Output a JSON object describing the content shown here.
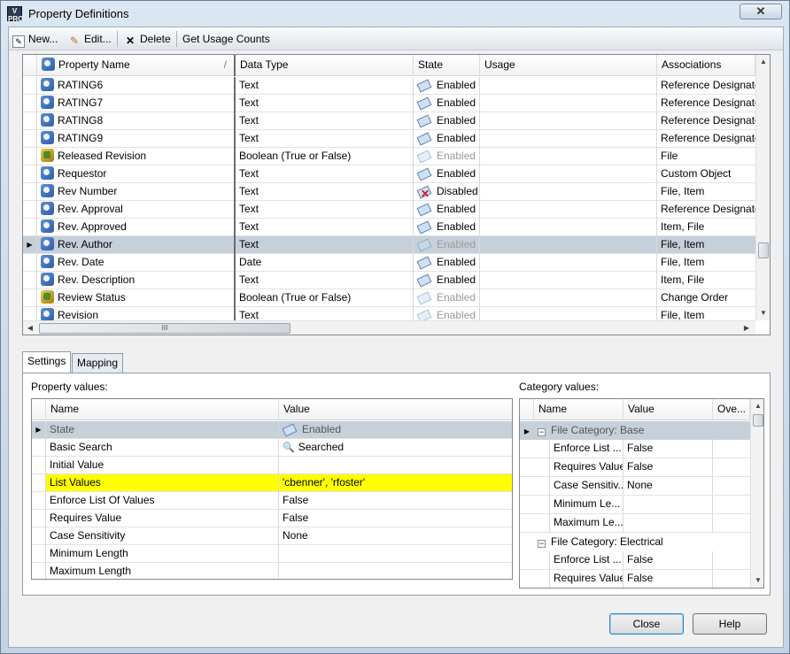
{
  "window": {
    "title": "Property Definitions",
    "close_glyph": "✕"
  },
  "toolbar": {
    "new_label": "New...",
    "edit_label": "Edit...",
    "delete_label": "Delete",
    "usage_label": "Get Usage Counts"
  },
  "property_grid": {
    "columns": [
      "Property Name",
      "Data Type",
      "State",
      "Usage",
      "Associations"
    ],
    "rows": [
      {
        "name": "RATING6",
        "type": "Text",
        "state": "Enabled",
        "state_style": "enabled",
        "usage": "",
        "assoc": "Reference Designator",
        "icon": "text"
      },
      {
        "name": "RATING7",
        "type": "Text",
        "state": "Enabled",
        "state_style": "enabled",
        "usage": "",
        "assoc": "Reference Designator",
        "icon": "text"
      },
      {
        "name": "RATING8",
        "type": "Text",
        "state": "Enabled",
        "state_style": "enabled",
        "usage": "",
        "assoc": "Reference Designator",
        "icon": "text"
      },
      {
        "name": "RATING9",
        "type": "Text",
        "state": "Enabled",
        "state_style": "enabled",
        "usage": "",
        "assoc": "Reference Designator",
        "icon": "text"
      },
      {
        "name": "Released Revision",
        "type": "Boolean (True or False)",
        "state": "Enabled",
        "state_style": "dim",
        "usage": "",
        "assoc": "File",
        "icon": "bool"
      },
      {
        "name": "Requestor",
        "type": "Text",
        "state": "Enabled",
        "state_style": "enabled",
        "usage": "",
        "assoc": "Custom Object",
        "icon": "text"
      },
      {
        "name": "Rev Number",
        "type": "Text",
        "state": "Disabled",
        "state_style": "disabled",
        "usage": "",
        "assoc": "File, Item",
        "icon": "text"
      },
      {
        "name": "Rev. Approval",
        "type": "Text",
        "state": "Enabled",
        "state_style": "enabled",
        "usage": "",
        "assoc": "Reference Designator",
        "icon": "text"
      },
      {
        "name": "Rev. Approved",
        "type": "Text",
        "state": "Enabled",
        "state_style": "enabled",
        "usage": "",
        "assoc": "Item, File",
        "icon": "text"
      },
      {
        "name": "Rev. Author",
        "type": "Text",
        "state": "Enabled",
        "state_style": "dim",
        "usage": "",
        "assoc": "File, Item",
        "icon": "text",
        "selected": true
      },
      {
        "name": "Rev. Date",
        "type": "Date",
        "state": "Enabled",
        "state_style": "enabled",
        "usage": "",
        "assoc": "File, Item",
        "icon": "text"
      },
      {
        "name": "Rev. Description",
        "type": "Text",
        "state": "Enabled",
        "state_style": "enabled",
        "usage": "",
        "assoc": "Item, File",
        "icon": "text"
      },
      {
        "name": "Review Status",
        "type": "Boolean (True or False)",
        "state": "Enabled",
        "state_style": "dim",
        "usage": "",
        "assoc": "Change Order",
        "icon": "bool"
      },
      {
        "name": "Revision",
        "type": "Text",
        "state": "Enabled",
        "state_style": "dim",
        "usage": "",
        "assoc": "File, Item",
        "icon": "text"
      }
    ],
    "hscroll_grip": "III"
  },
  "tabs": [
    "Settings",
    "Mapping"
  ],
  "settings": {
    "property_values_label": "Property values:",
    "category_values_label": "Category values:",
    "pv_columns": [
      "Name",
      "Value"
    ],
    "pv_rows": [
      {
        "name": "State",
        "value": "Enabled",
        "icon": "state",
        "selected": true
      },
      {
        "name": "Basic Search",
        "value": "Searched",
        "icon": "search"
      },
      {
        "name": "Initial Value",
        "value": ""
      },
      {
        "name": "List Values",
        "value": "'cbenner', 'rfoster'",
        "highlight": true
      },
      {
        "name": "Enforce List Of Values",
        "value": "False"
      },
      {
        "name": "Requires Value",
        "value": "False"
      },
      {
        "name": "Case Sensitivity",
        "value": "None"
      },
      {
        "name": "Minimum Length",
        "value": ""
      },
      {
        "name": "Maximum Length",
        "value": ""
      }
    ],
    "cv_columns": [
      "Name",
      "Value",
      "Ove..."
    ],
    "cv_groups": [
      {
        "label": "File Category: Base",
        "rows": [
          {
            "name": "Enforce List ...",
            "value": "False"
          },
          {
            "name": "Requires Value",
            "value": "False"
          },
          {
            "name": "Case Sensitiv...",
            "value": "None"
          },
          {
            "name": "Minimum Le...",
            "value": ""
          },
          {
            "name": "Maximum Le...",
            "value": ""
          }
        ]
      },
      {
        "label": "File Category: Electrical",
        "rows": [
          {
            "name": "Enforce List ...",
            "value": "False"
          },
          {
            "name": "Requires Value",
            "value": "False"
          }
        ]
      }
    ]
  },
  "buttons": {
    "close": "Close",
    "help": "Help"
  }
}
